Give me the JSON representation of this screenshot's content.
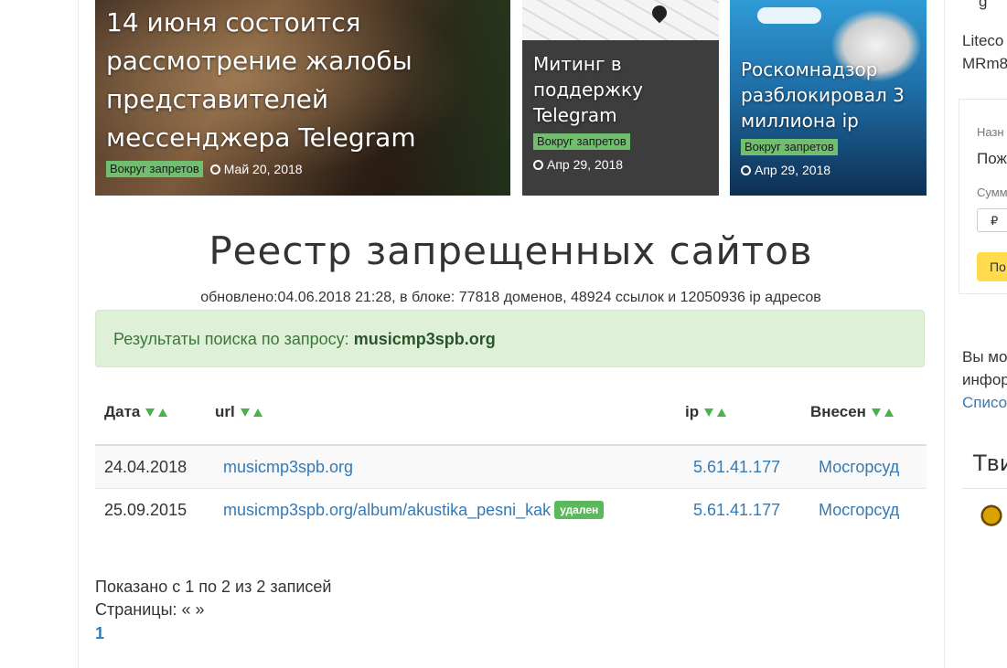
{
  "news_cards": [
    {
      "title": "14 июня состоится рассмотрение жалобы представителей мессенджера Telegram",
      "tag": "Вокруг запретов",
      "date": "Май 20, 2018"
    },
    {
      "title": "Митинг в поддержку Telegram",
      "tag": "Вокруг запретов",
      "date": "Апр 29, 2018"
    },
    {
      "title": "Роскомнадзор разблокировал 3 миллиона ip",
      "tag": "Вокруг запретов",
      "date": "Апр 29, 2018"
    }
  ],
  "heading": "Реестр запрещенных сайтов",
  "updated": "обновлено:04.06.2018 21:28, в блоке: 77818 доменов, 48924 ссылок и 12050936 ip адресов",
  "search": {
    "label": "Результаты поиска по запросу:",
    "query": "musicmp3spb.org"
  },
  "table": {
    "headers": [
      "Дата",
      "url",
      "ip",
      "Внесен"
    ],
    "rows": [
      {
        "date": "24.04.2018",
        "url": "musicmp3spb.org",
        "ip": "5.61.41.177",
        "court": "Мосгорсуд",
        "badge": ""
      },
      {
        "date": "25.09.2015",
        "url": "musicmp3spb.org/album/akustika_pesni_kak",
        "ip": "5.61.41.177",
        "court": "Мосгорсуд",
        "badge": "удален"
      }
    ]
  },
  "summary": "Показано с 1 по 2 из 2 записей",
  "pages_label": "Страницы: « »",
  "current_page": "1",
  "sidebar": {
    "top_cut": "g",
    "crypto_line1": "Liteco",
    "crypto_line2": "MRm8",
    "form_label1": "Назн",
    "form_value1": "Пож",
    "form_label2": "Сумм",
    "currency": "₽",
    "button": "По",
    "text1": "Вы мо",
    "text2": "инфор",
    "link": "Списо",
    "heading": "Тви"
  },
  "colors": {
    "accent": "#337ab7",
    "alert_bg": "#dff0d8",
    "tag": "#6fbf6f",
    "button": "#ffdb4d"
  }
}
